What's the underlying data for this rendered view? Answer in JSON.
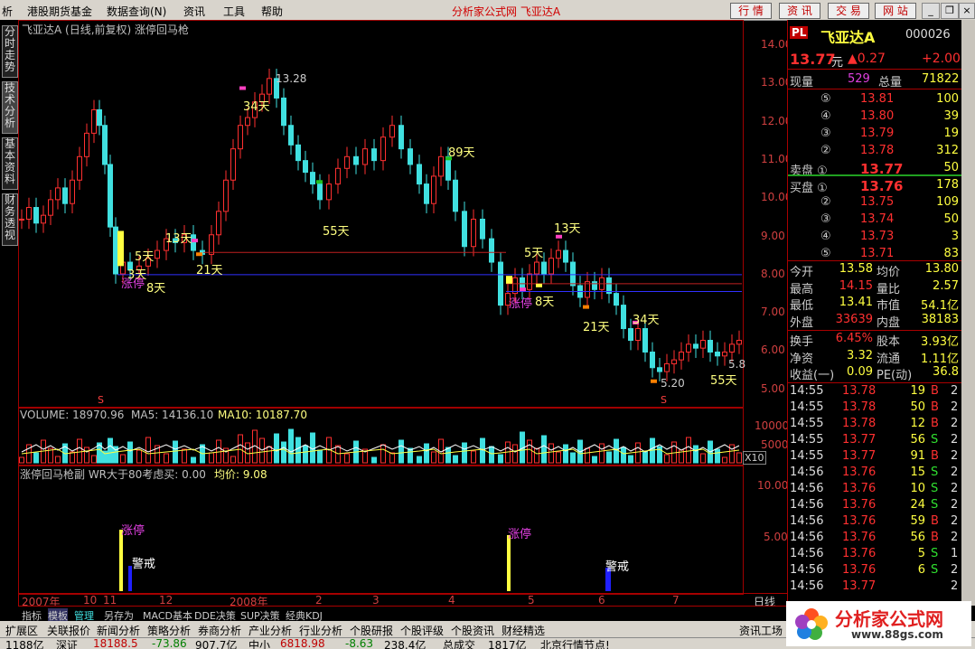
{
  "menu": {
    "items": [
      "析",
      "港股期货基金",
      "数据查询(N)",
      "资讯",
      "工具",
      "帮助"
    ],
    "center_title": "分析家公式网  飞亚达A",
    "buttons": [
      "行 情",
      "资 讯",
      "交 易",
      "网 站"
    ]
  },
  "left_tabs": [
    "分时走势",
    "技术分析",
    "基本资料",
    "财务透视"
  ],
  "main_chart": {
    "title": "飞亚达A (日线,前复权) 涨停回马枪",
    "y_ticks": [
      "14.00",
      "13.00",
      "12.00",
      "11.00",
      "10.00",
      "9.00",
      "8.00",
      "7.00",
      "6.00",
      "5.00"
    ],
    "high_label": "13.28",
    "low_label": "5.20",
    "last_label": "5.8",
    "annotations": [
      {
        "text": "34天",
        "color": "#ffff80"
      },
      {
        "text": "89天",
        "color": "#ffff80"
      },
      {
        "text": "55天",
        "color": "#ffff80"
      },
      {
        "text": "13天",
        "color": "#ffff80"
      },
      {
        "text": "5天",
        "color": "#ffff80"
      },
      {
        "text": "21天",
        "color": "#ffff80"
      },
      {
        "text": "8天",
        "color": "#ffff80"
      },
      {
        "text": "3天",
        "color": "#ffff80"
      },
      {
        "text": "涨停",
        "color": "#e040e0"
      },
      {
        "text": "13天",
        "color": "#ffff80"
      },
      {
        "text": "5天",
        "color": "#ffff80"
      },
      {
        "text": "涨停",
        "color": "#e040e0"
      },
      {
        "text": "8天",
        "color": "#ffff80"
      },
      {
        "text": "21天",
        "color": "#ffff80"
      },
      {
        "text": "34天",
        "color": "#ffff80"
      },
      {
        "text": "55天",
        "color": "#ffff80"
      }
    ],
    "marker_s": "S"
  },
  "volume_chart": {
    "title": "VOLUME: 18970.96",
    "ma5": "MA5: 14136.10",
    "ma10": "MA10: 10187.70",
    "y_ticks": [
      "10000",
      "5000"
    ],
    "multiplier": "X10"
  },
  "indicator_chart": {
    "title": "涨停回马枪副  WR大于80考虑买: 0.00",
    "avg_price": "均价: 9.08",
    "y_ticks": [
      "10.00",
      "5.00"
    ],
    "labels": [
      "涨停",
      "警戒",
      "涨停",
      "警戒"
    ]
  },
  "time_axis": [
    "2007年",
    "10",
    "11",
    "12",
    "2008年",
    "2",
    "3",
    "4",
    "5",
    "6",
    "7"
  ],
  "time_axis_right": "日线",
  "bottom_tabs": [
    "指标",
    "模板",
    "管理",
    "另存为",
    "MACD基本",
    "DDE决策",
    "SUP决策",
    "经典KDJ"
  ],
  "nav_bar": [
    "扩展区",
    "关联报价",
    "新闻分析",
    "策略分析",
    "券商分析",
    "产业分析",
    "行业分析",
    "个股研报",
    "个股评级",
    "个股资讯",
    "财经精选",
    "资讯工场"
  ],
  "status_bar": [
    "1188亿",
    "深证",
    "18188.5",
    "-73.86",
    "907.7亿",
    "中小",
    "6818.98",
    "-8.63",
    "238.4亿",
    "总成交",
    "1817亿",
    "北京行情节点!"
  ],
  "quote": {
    "badge": "PL",
    "name": "飞亚达A",
    "code": "000026",
    "price": "13.77",
    "price_unit": "元",
    "change": "▲0.27",
    "change_pct": "+2.00",
    "current_vol_label": "现量",
    "current_vol": "529",
    "total_vol_label": "总量",
    "total_vol": "71822",
    "asks": [
      {
        "lvl": "⑤",
        "price": "13.81",
        "vol": "100"
      },
      {
        "lvl": "④",
        "price": "13.80",
        "vol": "39"
      },
      {
        "lvl": "③",
        "price": "13.79",
        "vol": "19"
      },
      {
        "lvl": "②",
        "price": "13.78",
        "vol": "312"
      },
      {
        "lvl": "卖盘 ①",
        "price": "13.77",
        "vol": "50"
      }
    ],
    "bids": [
      {
        "lvl": "买盘 ①",
        "price": "13.76",
        "vol": "178"
      },
      {
        "lvl": "②",
        "price": "13.75",
        "vol": "109"
      },
      {
        "lvl": "③",
        "price": "13.74",
        "vol": "50"
      },
      {
        "lvl": "④",
        "price": "13.73",
        "vol": "3"
      },
      {
        "lvl": "⑤",
        "price": "13.71",
        "vol": "83"
      }
    ],
    "stats": [
      {
        "l1": "今开",
        "v1": "13.58",
        "l2": "均价",
        "v2": "13.80"
      },
      {
        "l1": "最高",
        "v1": "14.15",
        "l2": "量比",
        "v2": "2.57"
      },
      {
        "l1": "最低",
        "v1": "13.41",
        "l2": "市值",
        "v2": "54.1亿"
      },
      {
        "l1": "外盘",
        "v1": "33639",
        "l2": "内盘",
        "v2": "38183"
      }
    ],
    "stats2": [
      {
        "l1": "换手",
        "v1": "6.45%",
        "l2": "股本",
        "v2": "3.93亿"
      },
      {
        "l1": "净资",
        "v1": "3.32",
        "l2": "流通",
        "v2": "1.11亿"
      },
      {
        "l1": "收益(一)",
        "v1": "0.09",
        "l2": "PE(动)",
        "v2": "36.8"
      }
    ],
    "ticks": [
      {
        "t": "14:55",
        "p": "13.78",
        "v": "19",
        "d": "B",
        "n": "2"
      },
      {
        "t": "14:55",
        "p": "13.78",
        "v": "50",
        "d": "B",
        "n": "2"
      },
      {
        "t": "14:55",
        "p": "13.78",
        "v": "12",
        "d": "B",
        "n": "2"
      },
      {
        "t": "14:55",
        "p": "13.77",
        "v": "56",
        "d": "S",
        "n": "2"
      },
      {
        "t": "14:55",
        "p": "13.77",
        "v": "91",
        "d": "B",
        "n": "2"
      },
      {
        "t": "14:56",
        "p": "13.76",
        "v": "15",
        "d": "S",
        "n": "2"
      },
      {
        "t": "14:56",
        "p": "13.76",
        "v": "10",
        "d": "S",
        "n": "2"
      },
      {
        "t": "14:56",
        "p": "13.76",
        "v": "24",
        "d": "S",
        "n": "2"
      },
      {
        "t": "14:56",
        "p": "13.76",
        "v": "59",
        "d": "B",
        "n": "2"
      },
      {
        "t": "14:56",
        "p": "13.76",
        "v": "56",
        "d": "B",
        "n": "2"
      },
      {
        "t": "14:56",
        "p": "13.76",
        "v": "5",
        "d": "S",
        "n": "1"
      },
      {
        "t": "14:56",
        "p": "13.76",
        "v": "6",
        "d": "S",
        "n": "2"
      },
      {
        "t": "14:56",
        "p": "13.77",
        "v": "",
        "d": "",
        "n": "2"
      }
    ]
  },
  "logo": {
    "text": "分析家公式网",
    "url": "www.88gs.com"
  },
  "colors": {
    "up": "#ff3030",
    "down": "#40e0e0",
    "axis": "#a00000",
    "yellow": "#ffff40",
    "magenta": "#e040e0"
  }
}
